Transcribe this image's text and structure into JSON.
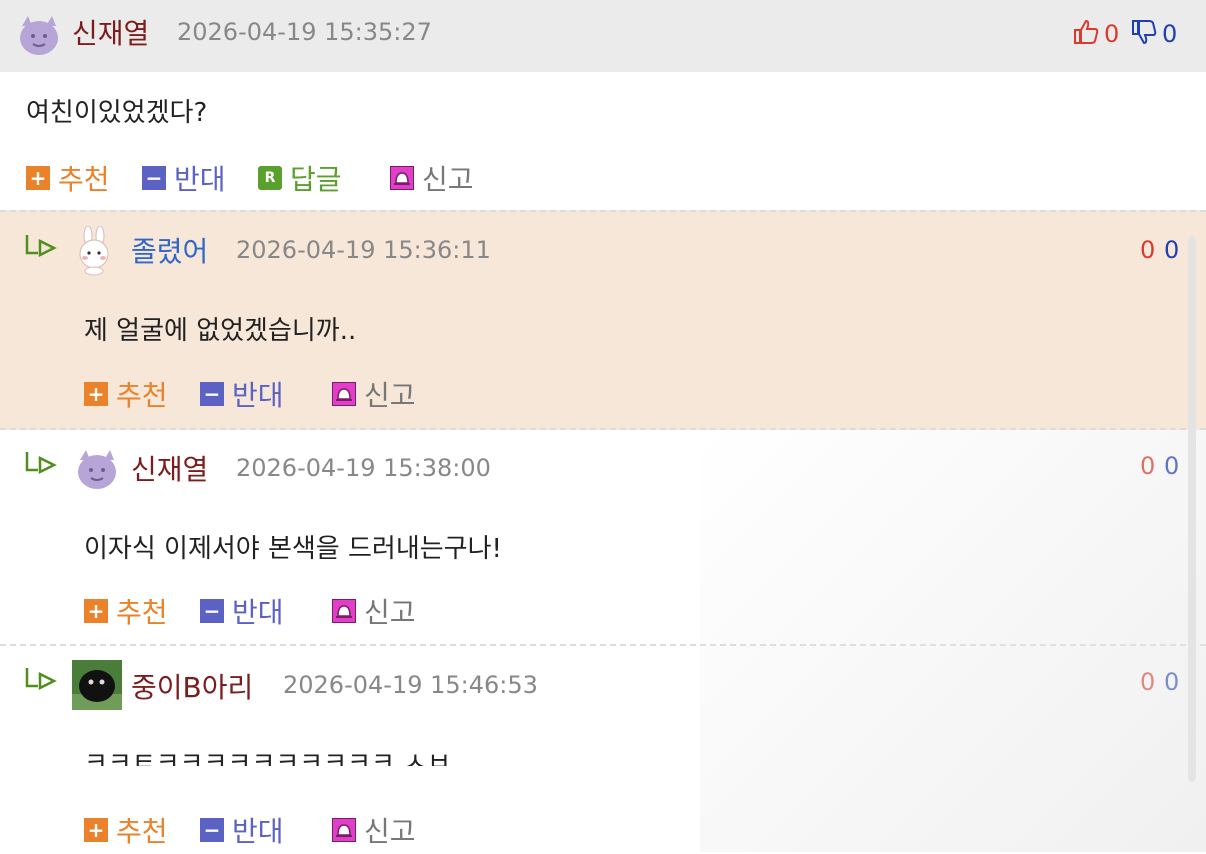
{
  "main_comment": {
    "author": "신재열",
    "date": "2026-04-19 15:35:27",
    "likes": "0",
    "dislikes": "0",
    "text": "여친이있었겠다?",
    "actions": {
      "recommend": "추천",
      "oppose": "반대",
      "reply": "답글",
      "report": "신고"
    }
  },
  "replies": [
    {
      "author": "졸렸어",
      "date": "2026-04-19 15:36:11",
      "likes": "0",
      "dislikes": "0",
      "text": "제 얼굴에 없었겠습니까..",
      "actions": {
        "recommend": "추천",
        "oppose": "반대",
        "report": "신고"
      }
    },
    {
      "author": "신재열",
      "date": "2026-04-19 15:38:00",
      "likes": "0",
      "dislikes": "0",
      "text": "이자식 이제서야 본색을 드러내는구나!",
      "actions": {
        "recommend": "추천",
        "oppose": "반대",
        "report": "신고"
      }
    },
    {
      "author": "중이B아리",
      "date": "2026-04-19 15:46:53",
      "likes": "0",
      "dislikes": "0",
      "text": "ㅋㅋㅌㅋㅋㅋㅋㅋㅋㅋㅋㅋㅋ ㅅㅂ",
      "actions": {
        "recommend": "추천",
        "oppose": "반대",
        "report": "신고"
      }
    }
  ],
  "icons": {
    "plus": "+",
    "minus": "−",
    "reply": "R",
    "thumb_up": "thumb-up-icon",
    "thumb_down": "thumb-down-icon",
    "reply_arrow": "reply-arrow-icon",
    "report": "siren-icon"
  },
  "colors": {
    "author": "#7c1d1d",
    "author_blue": "#2f66c8",
    "vote_up": "#d83b2e",
    "vote_down": "#1f3fb3",
    "highlight": "#f6e7d8"
  }
}
